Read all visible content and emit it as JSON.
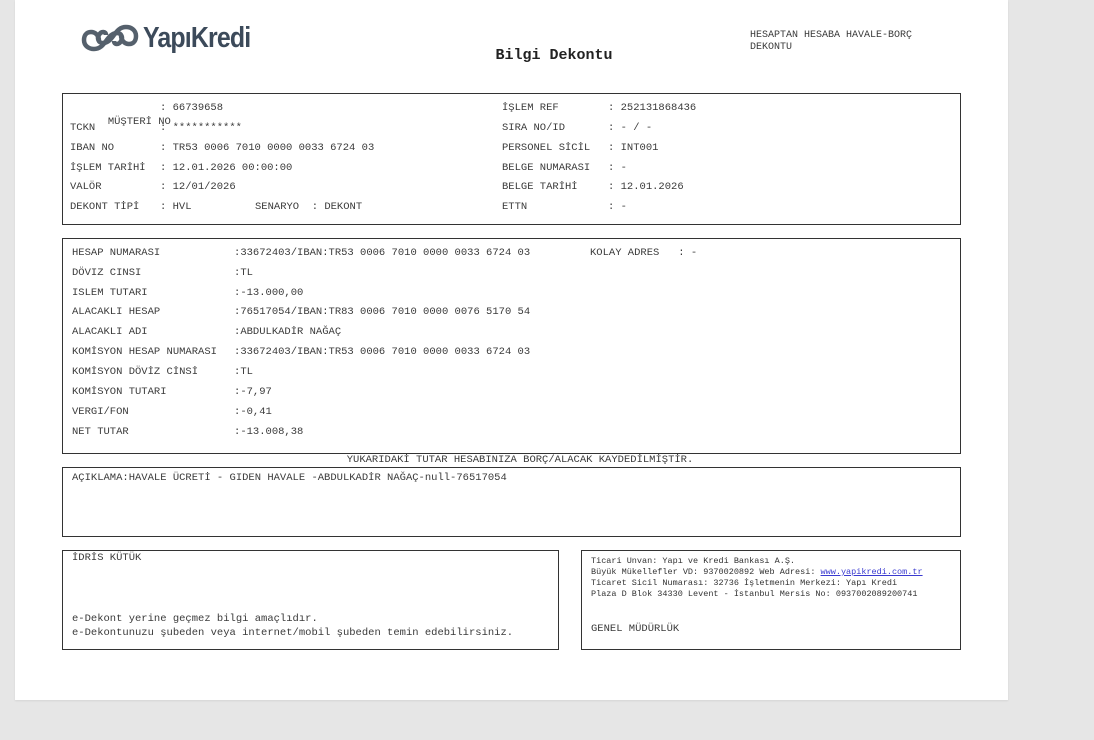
{
  "header": {
    "logo_text": "YapıKredi",
    "title": "Bilgi Dekontu",
    "doc_type": "HESAPTAN HESABA HAVALE-BORÇ DEKONTU"
  },
  "info_left": [
    {
      "label": "MÜŞTERİ NO",
      "value": "66739658"
    },
    {
      "label": "TCKN",
      "value": "***********"
    },
    {
      "label": "IBAN NO",
      "value": "TR53 0006 7010 0000 0033 6724 03"
    },
    {
      "label": "İŞLEM TARİHİ",
      "value": "12.01.2026 00:00:00"
    },
    {
      "label": "VALÖR",
      "value": "12/01/2026"
    },
    {
      "label": "DEKONT TİPİ",
      "value": "HVL",
      "extra_label": "SENARYO",
      "extra_value": "DEKONT"
    }
  ],
  "info_right": [
    {
      "label": "İŞLEM REF",
      "value": "252131868436"
    },
    {
      "label": "SIRA NO/ID",
      "value": "- / -"
    },
    {
      "label": "PERSONEL SİCİL",
      "value": "INT001"
    },
    {
      "label": "BELGE NUMARASI",
      "value": "-"
    },
    {
      "label": "BELGE TARİHİ",
      "value": "12.01.2026"
    },
    {
      "label": "ETTN",
      "value": "-"
    }
  ],
  "details": [
    {
      "label": "HESAP NUMARASI",
      "value": "33672403/IBAN:TR53 0006 7010 0000 0033 6724 03"
    },
    {
      "label": "DÖVIZ CINSI",
      "value": "TL"
    },
    {
      "label": "ISLEM TUTARI",
      "value": "-13.000,00"
    },
    {
      "label": "ALACAKLI HESAP",
      "value": "76517054/IBAN:TR83 0006 7010 0000 0076 5170 54"
    },
    {
      "label": "ALACAKLI ADI",
      "value": "ABDULKADİR NAĞAÇ"
    },
    {
      "label": "KOMİSYON HESAP NUMARASI",
      "value": "33672403/IBAN:TR53 0006 7010 0000 0033 6724 03"
    },
    {
      "label": "KOMİSYON DÖVİZ CİNSİ",
      "value": "TL"
    },
    {
      "label": "KOMİSYON TUTARI",
      "value": "-7,97"
    },
    {
      "label": "VERGI/FON",
      "value": "-0,41"
    },
    {
      "label": "NET TUTAR",
      "value": "-13.008,38"
    }
  ],
  "kolay_adres": {
    "label": "KOLAY ADRES",
    "value": "-"
  },
  "notice": "YUKARIDAKİ TUTAR HESABINIZA BORÇ/ALACAK KAYDEDİLMİŞTİR.",
  "description": "AÇIKLAMA:HAVALE ÜCRETİ - GIDEN HAVALE -ABDULKADİR NAĞAÇ-null-76517054",
  "customer": {
    "name": "İDRİS KÜTÜK",
    "note1": "e-Dekont yerine geçmez bilgi amaçlıdır.",
    "note2": "e-Dekontunuzu şubeden veya internet/mobil şubeden temin edebilirsiniz."
  },
  "bank": {
    "line1": "Ticari Unvan: Yapı ve Kredi Bankası A.Ş.",
    "line2_prefix": "Büyük Mükellefler VD: 9370020892 Web Adresi: ",
    "web_link": "www.yapikredi.com.tr",
    "line3": "Ticaret Sicil Numarası: 32736 İşletmenin Merkezi: Yapı Kredi",
    "line4": "Plaza D Blok 34330 Levent - İstanbul Mersis No: 0937002089200741",
    "branch": "GENEL MÜDÜRLÜK"
  }
}
